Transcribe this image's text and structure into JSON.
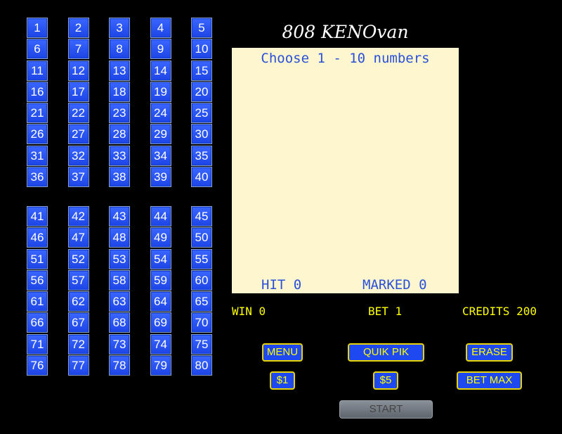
{
  "title": "808 KENOvan",
  "board": {
    "instruction": "Choose 1 - 10 numbers",
    "hit_label": "HIT 0",
    "marked_label": "MARKED 0"
  },
  "numbers_top": [
    "1",
    "2",
    "3",
    "4",
    "5",
    "6",
    "7",
    "8",
    "9",
    "10",
    "11",
    "12",
    "13",
    "14",
    "15",
    "16",
    "17",
    "18",
    "19",
    "20",
    "21",
    "22",
    "23",
    "24",
    "25",
    "26",
    "27",
    "28",
    "29",
    "30",
    "31",
    "32",
    "33",
    "34",
    "35",
    "36",
    "37",
    "38",
    "39",
    "40"
  ],
  "numbers_bottom": [
    "41",
    "42",
    "43",
    "44",
    "45",
    "46",
    "47",
    "48",
    "49",
    "50",
    "51",
    "52",
    "53",
    "54",
    "55",
    "56",
    "57",
    "58",
    "59",
    "60",
    "61",
    "62",
    "63",
    "64",
    "65",
    "66",
    "67",
    "68",
    "69",
    "70",
    "71",
    "72",
    "73",
    "74",
    "75",
    "76",
    "77",
    "78",
    "79",
    "80"
  ],
  "status": {
    "win": "WIN 0",
    "bet": "BET 1",
    "credits": "CREDITS 200"
  },
  "buttons": {
    "menu": "MENU",
    "quik_pik": "QUIK PIK",
    "erase": "ERASE",
    "one_dollar": "$1",
    "five_dollar": "$5",
    "bet_max": "BET MAX",
    "start": "START"
  },
  "colors": {
    "number_tile": "#2a55f0",
    "board_bg": "#fef6cf",
    "accent_yellow": "#ffff00",
    "board_text": "#2a50d8"
  }
}
